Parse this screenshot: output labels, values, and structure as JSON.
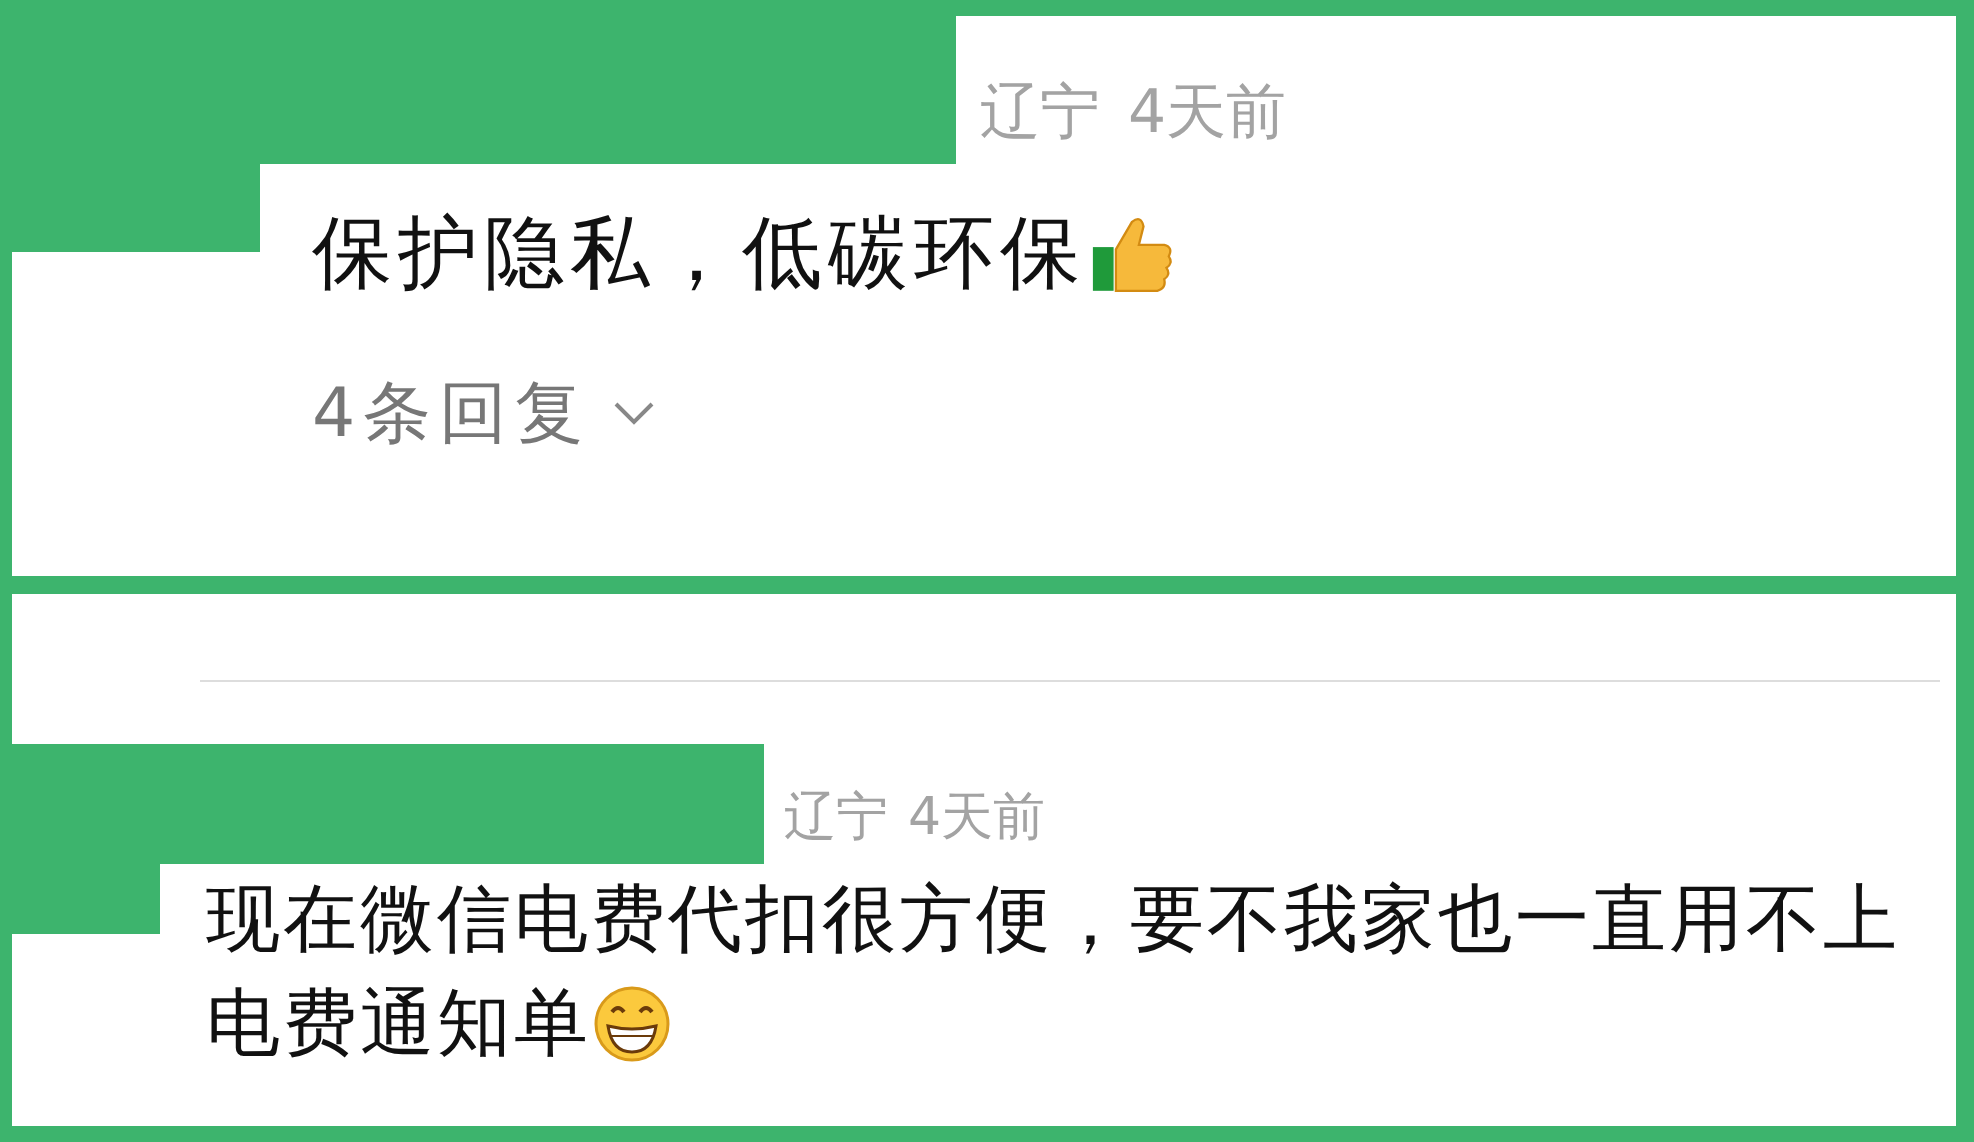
{
  "comments": [
    {
      "location": "辽宁",
      "time": "4天前",
      "text": "保护隐私，低碳环保",
      "replies": "4条回复",
      "divider": false
    },
    {
      "location": "辽宁",
      "time": "4天前",
      "lines": [
        "现在微信电费代扣很方便，要不我家也一直用不上",
        "电费通知单"
      ],
      "divider": true
    }
  ]
}
